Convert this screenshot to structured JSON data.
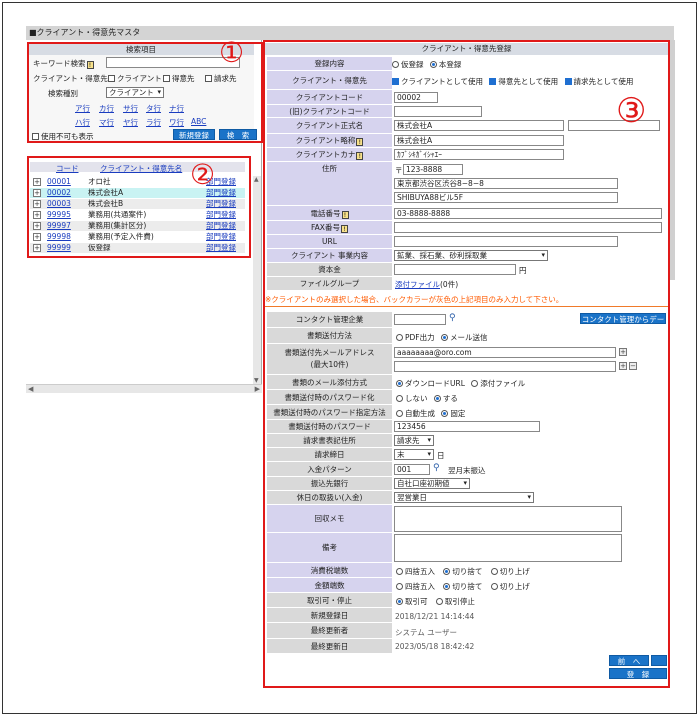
{
  "page_title": "■クライアント・得意先マスタ",
  "search": {
    "header": "検索項目",
    "keyword_label": "キーワード検索",
    "hint_glyph": "!",
    "keyword_value": "",
    "client_type_label": "クライアント・得意先",
    "chk_client": "クライアント",
    "chk_customer": "得意先",
    "chk_billing": "請求先",
    "search_type_label": "検索種別",
    "search_type_value": "クライアント",
    "kana_row1": [
      "ア行",
      "カ行",
      "サ行",
      "タ行",
      "ナ行"
    ],
    "kana_row2": [
      "ハ行",
      "マ行",
      "ヤ行",
      "ラ行",
      "ワ行",
      "ABC"
    ],
    "include_disabled_label": "使用不可も表示",
    "new_button": "新規登録",
    "search_button": "検　索"
  },
  "list": {
    "col_code": "コード",
    "col_name": "クライアント・得意先名",
    "rows": [
      {
        "code": "00001",
        "name": "オロ社",
        "dept": "部門登録"
      },
      {
        "code": "00002",
        "name": "株式会社A",
        "dept": "部門登録"
      },
      {
        "code": "00003",
        "name": "株式会社B",
        "dept": "部門登録"
      },
      {
        "code": "99995",
        "name": "業務用(共通案件)",
        "dept": "部門登録"
      },
      {
        "code": "99997",
        "name": "業務用(集計区分)",
        "dept": "部門登録"
      },
      {
        "code": "99998",
        "name": "業務用(予定入件費)",
        "dept": "部門登録"
      },
      {
        "code": "99999",
        "name": "仮登録",
        "dept": "部門登録"
      }
    ]
  },
  "annotations": {
    "n1": "①",
    "n2": "②",
    "n3": "③"
  },
  "form": {
    "header": "クライアント・得意先登録",
    "reg_label": "登録内容",
    "reg_opt1": "仮登録",
    "reg_opt2": "本登録",
    "type_label": "クライアント・得意先",
    "type_opt1": "クライアントとして使用",
    "type_opt2": "得意先として使用",
    "type_opt3": "請求先として使用",
    "code_label": "クライアントコード",
    "code_value": "00002",
    "old_code_label": "(旧)クライアントコード",
    "formal_name_label": "クライアント正式名",
    "formal_name_value": "株式会社A",
    "short_name_label": "クライアント略称",
    "short_name_value": "株式会社A",
    "kana_label": "クライアントカナ",
    "kana_value": "ｶﾌﾞｼｷｶﾞｲｼｬｴｰ",
    "address_label": "住所",
    "zip_prefix": "〒",
    "zip_value": "123-8888",
    "addr1": "東京都渋谷区渋谷8−8−8",
    "addr2": "SHIBUYA88ビル5F",
    "tel_label": "電話番号",
    "tel_value": "03-8888-8888",
    "fax_label": "FAX番号",
    "url_label": "URL",
    "biz_label": "クライアント 事業内容",
    "biz_value": "鉱業、採石業、砂利採取業",
    "capital_label": "資本金",
    "capital_unit": "円",
    "filegroup_label": "ファイルグループ",
    "filegroup_link": "添付ファイル",
    "filegroup_count": "(0件)",
    "note": "※クライアントのみ選択した場合、バックカラーが灰色の上記項目のみ入力して下さい。",
    "contact_label": "コンタクト管理企業",
    "contact_btn": "コンタクト管理からデー",
    "send_method_label": "書類送付方法",
    "send_opt1": "PDF出力",
    "send_opt2": "メール送信",
    "mail_label": "書類送付先メールアドレス",
    "mail_sub": "(最大10件)",
    "mail_value": "aaaaaaaa@oro.com",
    "attach_label": "書類のメール添付方式",
    "attach_opt1": "ダウンロードURL",
    "attach_opt2": "添付ファイル",
    "pw_label": "書類送付時のパスワード化",
    "pw_opt1": "しない",
    "pw_opt2": "する",
    "pwspec_label": "書類送付時のパスワード指定方法",
    "pwspec_opt1": "自動生成",
    "pwspec_opt2": "固定",
    "pwval_label": "書類送付時のパスワード",
    "pwval_value": "123456",
    "billing_label": "請求書表記住所",
    "billing_value": "請求先",
    "closing_label": "請求締日",
    "closing_value": "末",
    "closing_unit": "日",
    "payment_label": "入金パターン",
    "payment_code": "001",
    "payment_text": "翌月末振込",
    "bank_label": "振込先銀行",
    "bank_value": "自社口座初期値",
    "holiday_label": "休日の取扱い(入金)",
    "holiday_value": "翌営業日",
    "memo_label": "回収メモ",
    "remark_label": "備考",
    "tax_label": "消費税端数",
    "round_opt1": "四捨五入",
    "round_opt2": "切り捨て",
    "round_opt3": "切り上げ",
    "amount_label": "金額端数",
    "trade_label": "取引可・停止",
    "trade_opt1": "取引可",
    "trade_opt2": "取引停止",
    "created_label": "新規登録日",
    "created_value": "2018/12/21 14:14:44",
    "updater_label": "最終更新者",
    "updater_value": "システム ユーザー",
    "updated_label": "最終更新日",
    "updated_value": "2023/05/18 18:42:42",
    "prev_btn": "前　へ",
    "save_btn": "登　録"
  }
}
